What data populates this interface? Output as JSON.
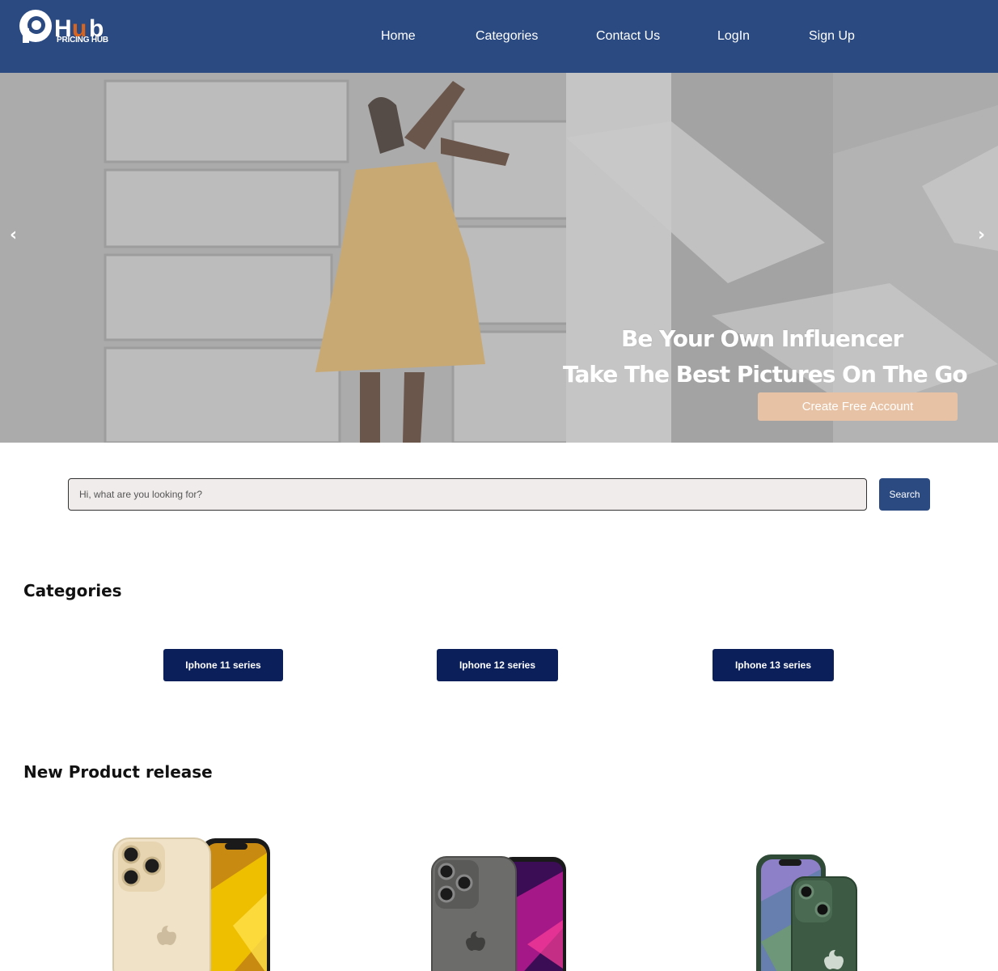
{
  "brand": {
    "logo_text": "Hub",
    "logo_subtitle": "PRICING HUB"
  },
  "nav": {
    "items": [
      {
        "label": "Home"
      },
      {
        "label": "Categories"
      },
      {
        "label": "Contact Us"
      },
      {
        "label": "LogIn"
      },
      {
        "label": "Sign Up"
      }
    ]
  },
  "hero": {
    "line1": "Be Your Own Influencer",
    "line2": "Take The Best Pictures On The Go",
    "cta_label": "Create Free Account",
    "prev_glyph": "‹",
    "next_glyph": "›"
  },
  "search": {
    "placeholder": "Hi, what are you looking for?",
    "button_label": "Search"
  },
  "categories": {
    "title": "Categories",
    "items": [
      {
        "label": "Iphone 11 series"
      },
      {
        "label": "Iphone 12 series"
      },
      {
        "label": "Iphone 13 series"
      }
    ]
  },
  "new_products": {
    "title": "New Product release"
  },
  "colors": {
    "header_bg": "#2b4a82",
    "category_button": "#0b1f5b",
    "cta": "#e8c2a4",
    "logo_accent": "#d9641e"
  }
}
